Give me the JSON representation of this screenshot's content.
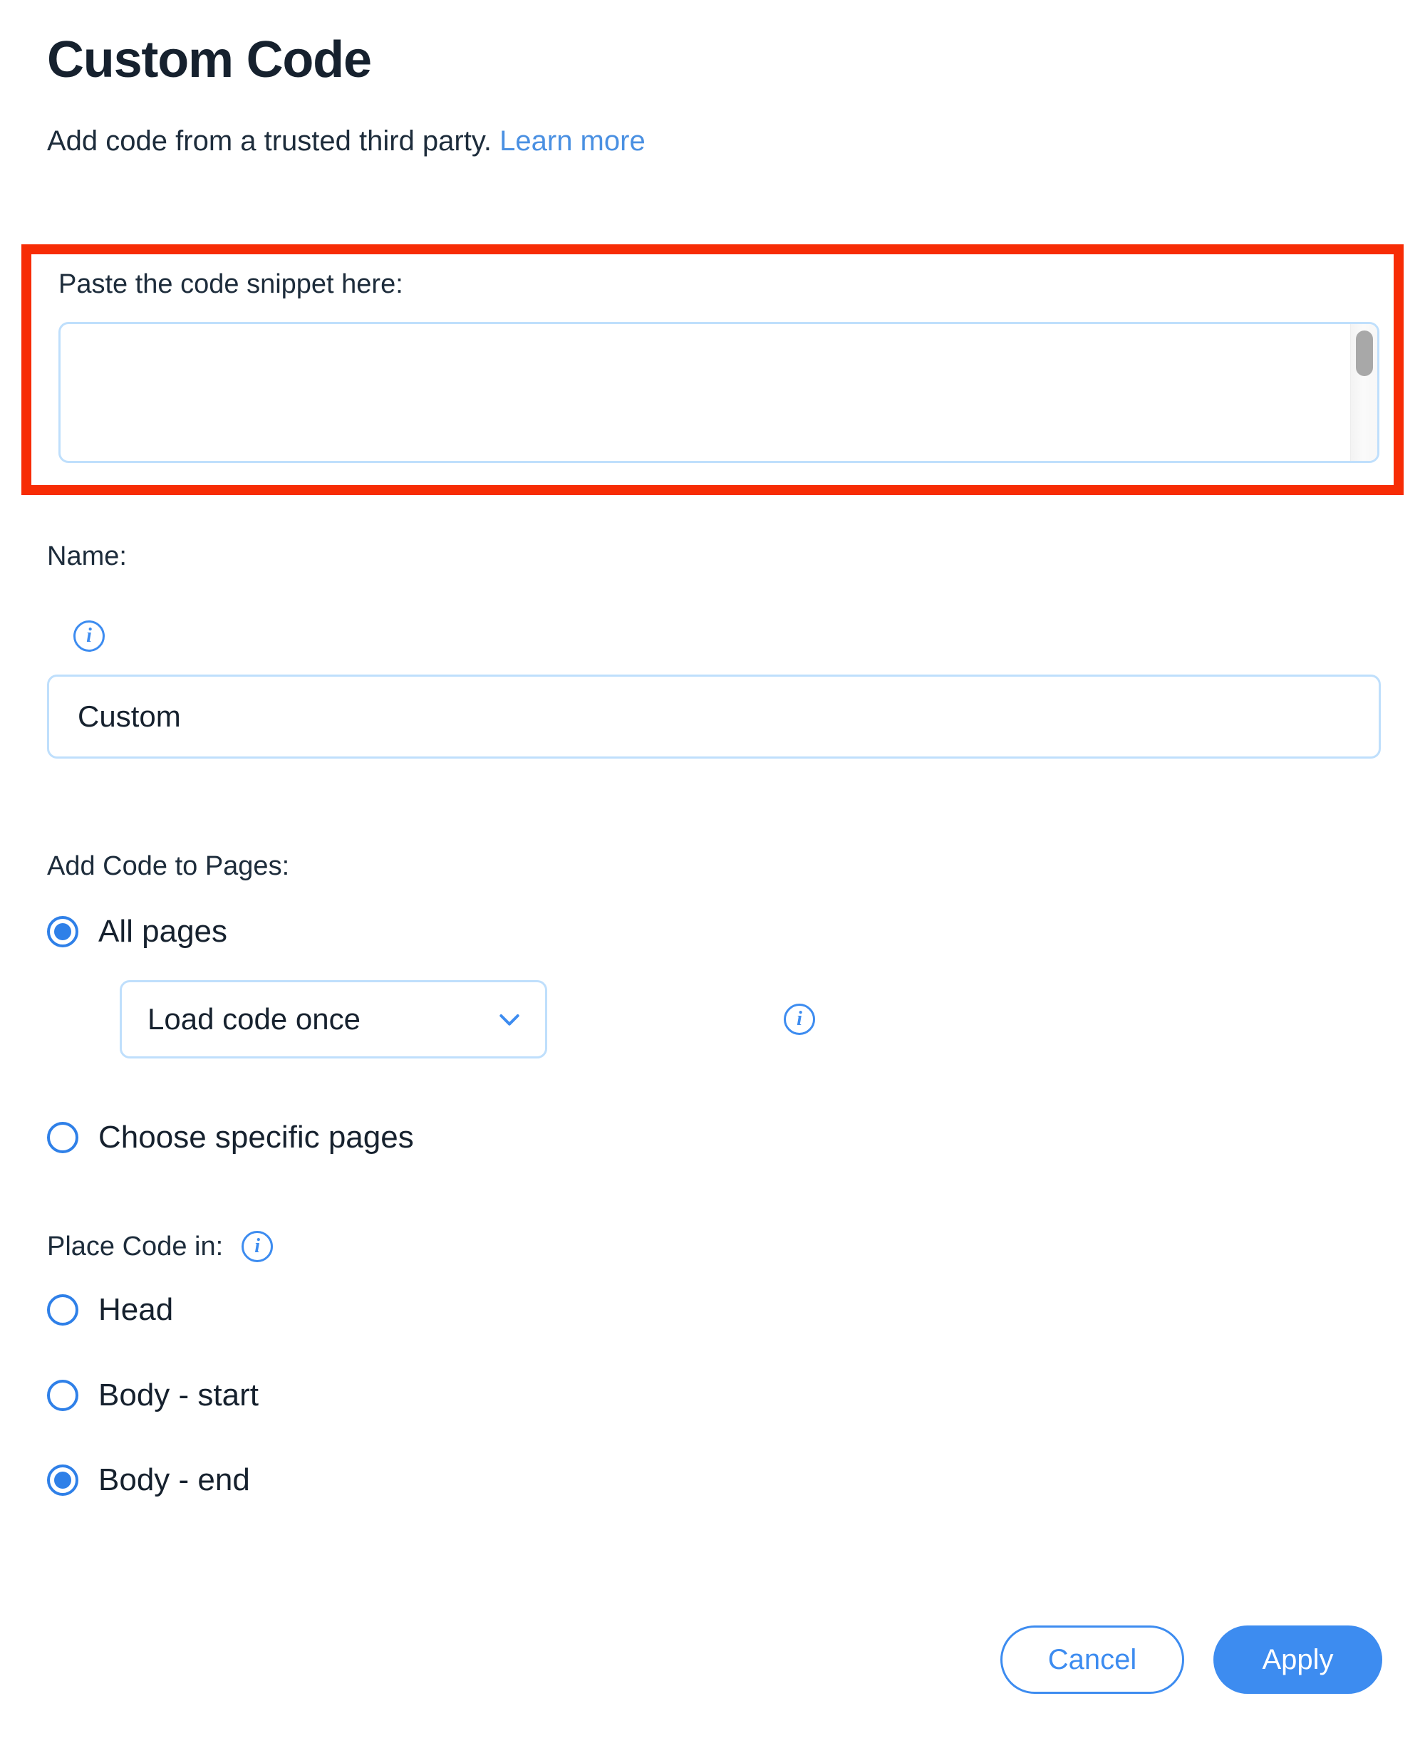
{
  "header": {
    "title": "Custom Code",
    "subtitle_text": "Add code from a trusted third party.",
    "learn_more_label": "Learn more"
  },
  "snippet": {
    "label": "Paste the code snippet here:",
    "value": "",
    "placeholder": "",
    "highlight_color": "#f72c05"
  },
  "name": {
    "label": "Name:",
    "info_glyph": "i",
    "value": "Custom",
    "placeholder": "Custom"
  },
  "add_code_to_pages": {
    "label": "Add Code to Pages:",
    "options": [
      {
        "label": "All pages",
        "selected": true
      },
      {
        "label": "Choose specific pages",
        "selected": false
      }
    ],
    "load_mode": {
      "selected": "Load code once",
      "chevron": "chevron-down-icon",
      "info_glyph": "i"
    }
  },
  "place_code_in": {
    "label": "Place Code in:",
    "info_glyph": "i",
    "options": [
      {
        "label": "Head",
        "selected": false
      },
      {
        "label": "Body - start",
        "selected": false
      },
      {
        "label": "Body - end",
        "selected": true
      }
    ]
  },
  "footer": {
    "cancel_label": "Cancel",
    "apply_label": "Apply"
  },
  "colors": {
    "accent_blue": "#3d8cf0",
    "radio_blue": "#2f80e8",
    "text_dark": "#16212e",
    "label_gray": "#1d2c3b",
    "field_border": "#bfdffc",
    "highlight_red": "#f72c05"
  }
}
